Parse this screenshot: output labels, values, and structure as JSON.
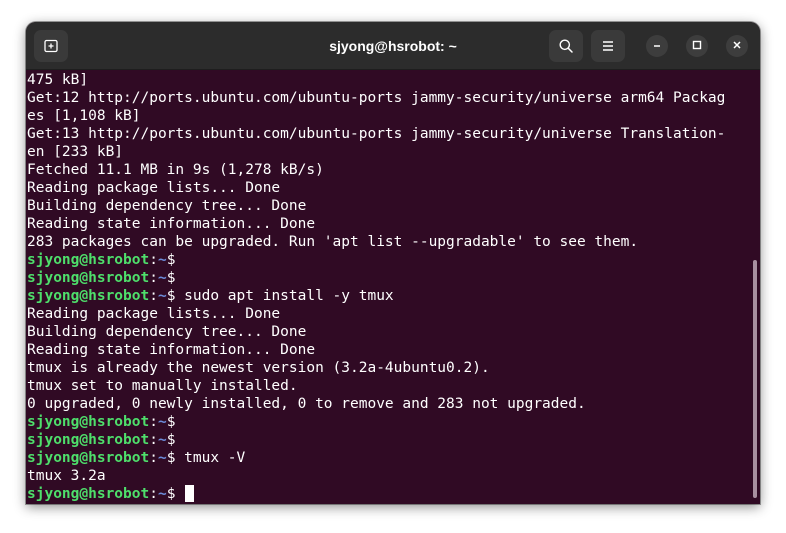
{
  "window": {
    "title": "sjyong@hsrobot: ~"
  },
  "icons": {
    "new_tab": "new-tab-icon",
    "search": "search-icon",
    "menu": "hamburger-menu-icon",
    "minimize": "minimize-icon",
    "maximize": "maximize-icon",
    "close": "close-icon"
  },
  "colors": {
    "terminal_bg": "#300a24",
    "prompt_user": "#4edf6b",
    "prompt_path": "#6c8bd8"
  },
  "prompt": {
    "user_host": "sjyong@hsrobot",
    "colon": ":",
    "path": "~",
    "symbol": "$"
  },
  "terminal": {
    "lines": [
      {
        "type": "output",
        "text": "475 kB]"
      },
      {
        "type": "output",
        "text": "Get:12 http://ports.ubuntu.com/ubuntu-ports jammy-security/universe arm64 Packag"
      },
      {
        "type": "output",
        "text": "es [1,108 kB]"
      },
      {
        "type": "output",
        "text": "Get:13 http://ports.ubuntu.com/ubuntu-ports jammy-security/universe Translation-"
      },
      {
        "type": "output",
        "text": "en [233 kB]"
      },
      {
        "type": "output",
        "text": "Fetched 11.1 MB in 9s (1,278 kB/s)"
      },
      {
        "type": "output",
        "text": "Reading package lists... Done"
      },
      {
        "type": "output",
        "text": "Building dependency tree... Done"
      },
      {
        "type": "output",
        "text": "Reading state information... Done"
      },
      {
        "type": "output",
        "text": "283 packages can be upgraded. Run 'apt list --upgradable' to see them."
      },
      {
        "type": "prompt",
        "command": ""
      },
      {
        "type": "prompt",
        "command": ""
      },
      {
        "type": "prompt",
        "command": " sudo apt install -y tmux"
      },
      {
        "type": "output",
        "text": "Reading package lists... Done"
      },
      {
        "type": "output",
        "text": "Building dependency tree... Done"
      },
      {
        "type": "output",
        "text": "Reading state information... Done"
      },
      {
        "type": "output",
        "text": "tmux is already the newest version (3.2a-4ubuntu0.2)."
      },
      {
        "type": "output",
        "text": "tmux set to manually installed."
      },
      {
        "type": "output",
        "text": "0 upgraded, 0 newly installed, 0 to remove and 283 not upgraded."
      },
      {
        "type": "prompt",
        "command": ""
      },
      {
        "type": "prompt",
        "command": ""
      },
      {
        "type": "prompt",
        "command": " tmux -V"
      },
      {
        "type": "output",
        "text": "tmux 3.2a"
      },
      {
        "type": "prompt",
        "command": " ",
        "cursor": true
      }
    ]
  }
}
